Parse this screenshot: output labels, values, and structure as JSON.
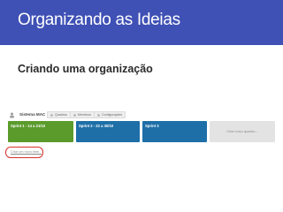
{
  "slide": {
    "title": "Organizando as Ideias",
    "subtitle": "Criando uma organização"
  },
  "board": {
    "name": "Sistema MAC",
    "buttons": [
      {
        "label": "Quadros",
        "icon": "board-icon"
      },
      {
        "label": "Membros",
        "icon": "members-icon"
      },
      {
        "label": "Configurações",
        "icon": "gear-icon"
      }
    ],
    "cards": [
      {
        "label": "Sprint 1 - 14 a 21/10",
        "color": "#5a9b2b"
      },
      {
        "label": "Sprint 2 - 22 a 30/10",
        "color": "#1e6fa8"
      },
      {
        "label": "Sprint 3",
        "color": "#1e6fa8"
      }
    ],
    "new_board_label": "Criar novo quadro...",
    "create_org_label": "Criar um novo time..."
  },
  "colors": {
    "banner": "#3f51b5",
    "highlight": "#d9302c"
  }
}
